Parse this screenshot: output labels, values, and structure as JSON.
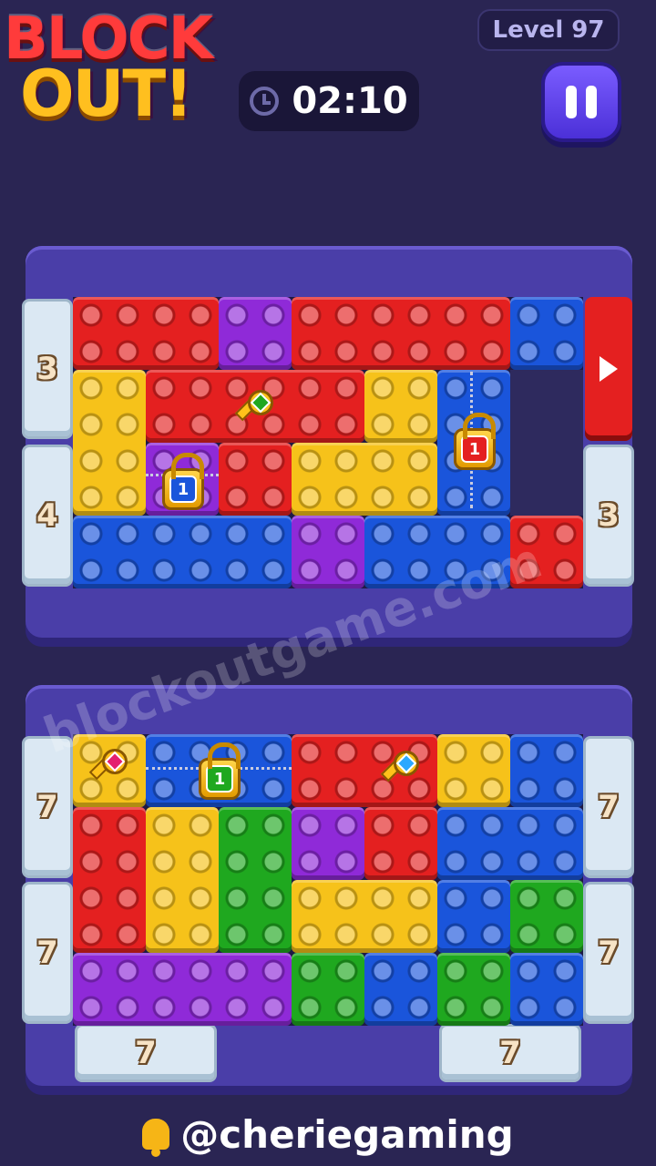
{
  "header": {
    "logo_line1": "BLOCK",
    "logo_line2": "OUT!",
    "level_label": "Level 97",
    "timer": "02:10",
    "pause_icon": "pause-icon",
    "timer_icon": "clock-icon"
  },
  "board1": {
    "exits": {
      "left_top": "3",
      "left_bottom": "4",
      "right_bottom": "3"
    },
    "locks": [
      "1",
      "1"
    ]
  },
  "board2": {
    "exits": {
      "left_top": "7",
      "left_bottom": "7",
      "right_top": "7",
      "right_bottom": "7",
      "bottom_left": "7",
      "bottom_right": "7"
    },
    "locks": [
      "1"
    ]
  },
  "watermark": "blockoutgame.com",
  "footer": {
    "handle": "@cheriegaming",
    "icon": "bell-icon"
  },
  "colors": {
    "red": "#e42020",
    "purple": "#8f2ad8",
    "blue": "#1a55db",
    "yellow": "#f6c21a",
    "green": "#1fa81f",
    "background": "#2a2553"
  }
}
